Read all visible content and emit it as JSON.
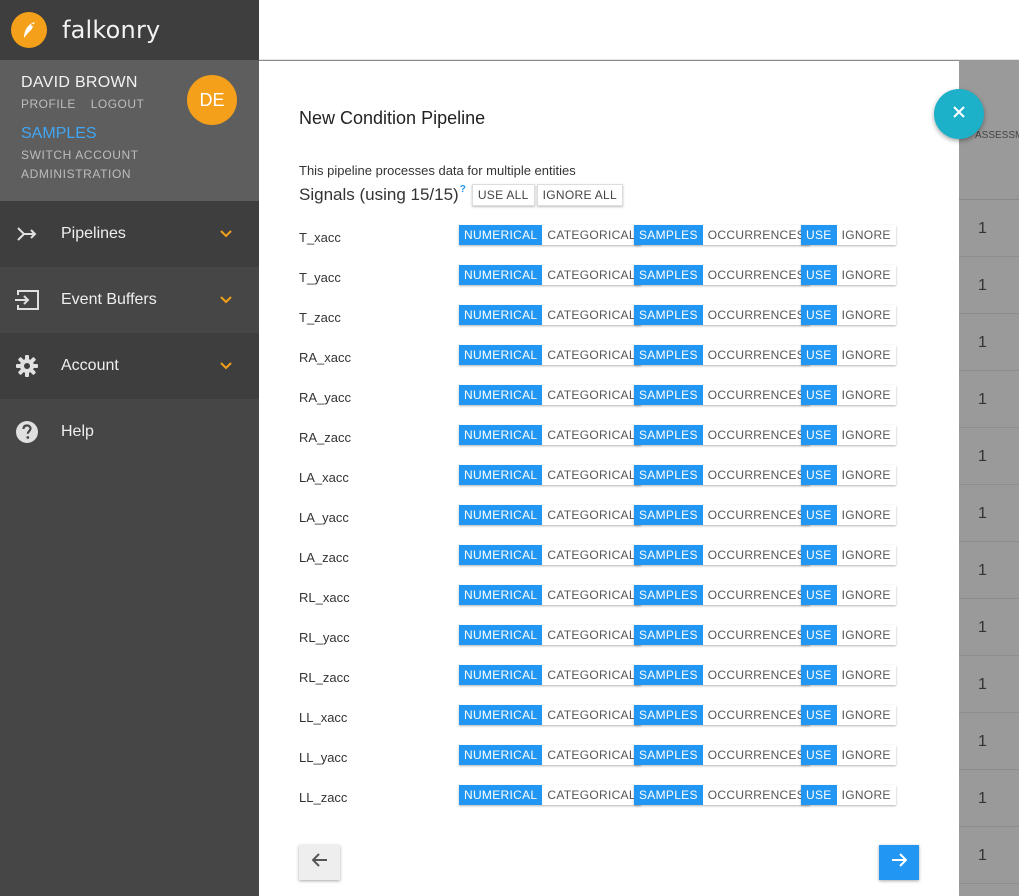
{
  "app": {
    "name": "falkonry"
  },
  "user": {
    "name": "DAVID BROWN",
    "initials": "DE",
    "profile_label": "PROFILE",
    "logout_label": "LOGOUT",
    "current_account": "SAMPLES",
    "switch_account_label": "SWITCH ACCOUNT",
    "administration_label": "ADMINISTRATION"
  },
  "nav": {
    "pipelines": "Pipelines",
    "event_buffers": "Event Buffers",
    "account": "Account",
    "help": "Help"
  },
  "background_table": {
    "header": "ASSESSM",
    "rows": [
      "1",
      "1",
      "1",
      "1",
      "1",
      "1",
      "1",
      "1",
      "1",
      "1",
      "1",
      "1"
    ]
  },
  "modal": {
    "title": "New Condition Pipeline",
    "subtitle": "This pipeline processes data for multiple entities",
    "signals_title": "Signals (using 15/15)",
    "help_mark": "?",
    "use_all_label": "USE ALL",
    "ignore_all_label": "IGNORE ALL",
    "toggle_labels": {
      "numerical": "NUMERICAL",
      "categorical": "CATEGORICAL",
      "samples": "SAMPLES",
      "occurrences": "OCCURRENCES",
      "use": "USE",
      "ignore": "IGNORE"
    },
    "signals": [
      {
        "name": "T_xacc",
        "type": "NUMERICAL",
        "mode": "SAMPLES",
        "usage": "USE"
      },
      {
        "name": "T_yacc",
        "type": "NUMERICAL",
        "mode": "SAMPLES",
        "usage": "USE"
      },
      {
        "name": "T_zacc",
        "type": "NUMERICAL",
        "mode": "SAMPLES",
        "usage": "USE"
      },
      {
        "name": "RA_xacc",
        "type": "NUMERICAL",
        "mode": "SAMPLES",
        "usage": "USE"
      },
      {
        "name": "RA_yacc",
        "type": "NUMERICAL",
        "mode": "SAMPLES",
        "usage": "USE"
      },
      {
        "name": "RA_zacc",
        "type": "NUMERICAL",
        "mode": "SAMPLES",
        "usage": "USE"
      },
      {
        "name": "LA_xacc",
        "type": "NUMERICAL",
        "mode": "SAMPLES",
        "usage": "USE"
      },
      {
        "name": "LA_yacc",
        "type": "NUMERICAL",
        "mode": "SAMPLES",
        "usage": "USE"
      },
      {
        "name": "LA_zacc",
        "type": "NUMERICAL",
        "mode": "SAMPLES",
        "usage": "USE"
      },
      {
        "name": "RL_xacc",
        "type": "NUMERICAL",
        "mode": "SAMPLES",
        "usage": "USE"
      },
      {
        "name": "RL_yacc",
        "type": "NUMERICAL",
        "mode": "SAMPLES",
        "usage": "USE"
      },
      {
        "name": "RL_zacc",
        "type": "NUMERICAL",
        "mode": "SAMPLES",
        "usage": "USE"
      },
      {
        "name": "LL_xacc",
        "type": "NUMERICAL",
        "mode": "SAMPLES",
        "usage": "USE"
      },
      {
        "name": "LL_yacc",
        "type": "NUMERICAL",
        "mode": "SAMPLES",
        "usage": "USE"
      },
      {
        "name": "LL_zacc",
        "type": "NUMERICAL",
        "mode": "SAMPLES",
        "usage": "USE"
      }
    ]
  },
  "icons": {
    "logo": "falkonry-bird-icon",
    "pipelines": "merge-arrow-icon",
    "event_buffers": "input-icon",
    "account": "gear-icon",
    "help": "help-circle-icon",
    "chevron": "chevron-down-icon",
    "back": "arrow-left-icon",
    "next": "arrow-right-icon",
    "close": "close-icon"
  },
  "colors": {
    "accent": "#2196f3",
    "brand_orange": "#f5a01a",
    "fab": "#1cb1c9",
    "sidebar": "#464646"
  }
}
